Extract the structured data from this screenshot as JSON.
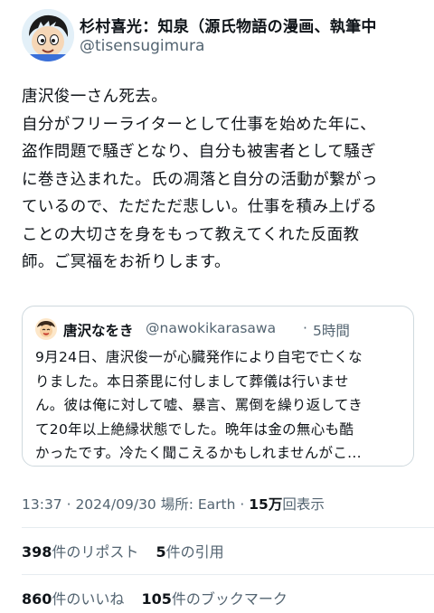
{
  "author": {
    "display_name": "杉村喜光：知泉（源氏物語の漫画、執筆中",
    "handle": "@tisensugimura",
    "avatar_icon": "cartoon-boy-avatar-icon"
  },
  "post": {
    "lines": [
      "唐沢俊一さん死去。",
      "自分がフリーライターとして仕事を始めた年に、",
      "盗作問題で騒ぎとなり、自分も被害者として騒ぎ",
      "に巻き込まれた。氏の凋落と自分の活動が繋がっ",
      "ているので、ただただ悲しい。仕事を積み上げる",
      "ことの大切さを身をもって教えてくれた反面教",
      "師。ご冥福をお祈りします。"
    ]
  },
  "quote": {
    "display_name": "唐沢なをき",
    "handle": "@nawokikarasawa",
    "separator": "·",
    "time": "5時間",
    "avatar_icon": "smiling-face-avatar-icon",
    "lines": [
      "9月24日、唐沢俊一が心臓発作により自宅で亡くな",
      "りました。本日荼毘に付しまして葬儀は行いませ",
      "ん。彼は俺に対して嘘、暴言、罵倒を繰り返してき",
      "て20年以上絶縁状態でした。晩年は金の無心も酷",
      "かったです。冷たく聞こえるかもしれませんがこ..."
    ]
  },
  "meta": {
    "timestamp": "13:37 · 2024/09/30",
    "location": "場所: Earth",
    "separator": "·",
    "views_count": "15万",
    "views_label": "回表示"
  },
  "stats": {
    "reposts_count": "398",
    "reposts_label": "件のリポスト",
    "quotes_count": "5",
    "quotes_label": "件の引用",
    "likes_count": "860",
    "likes_label": "件のいいね",
    "bookmarks_count": "105",
    "bookmarks_label": "件のブックマーク"
  },
  "colors": {
    "text": "#0f1419",
    "secondary": "#536471",
    "border": "#cfd9de"
  }
}
